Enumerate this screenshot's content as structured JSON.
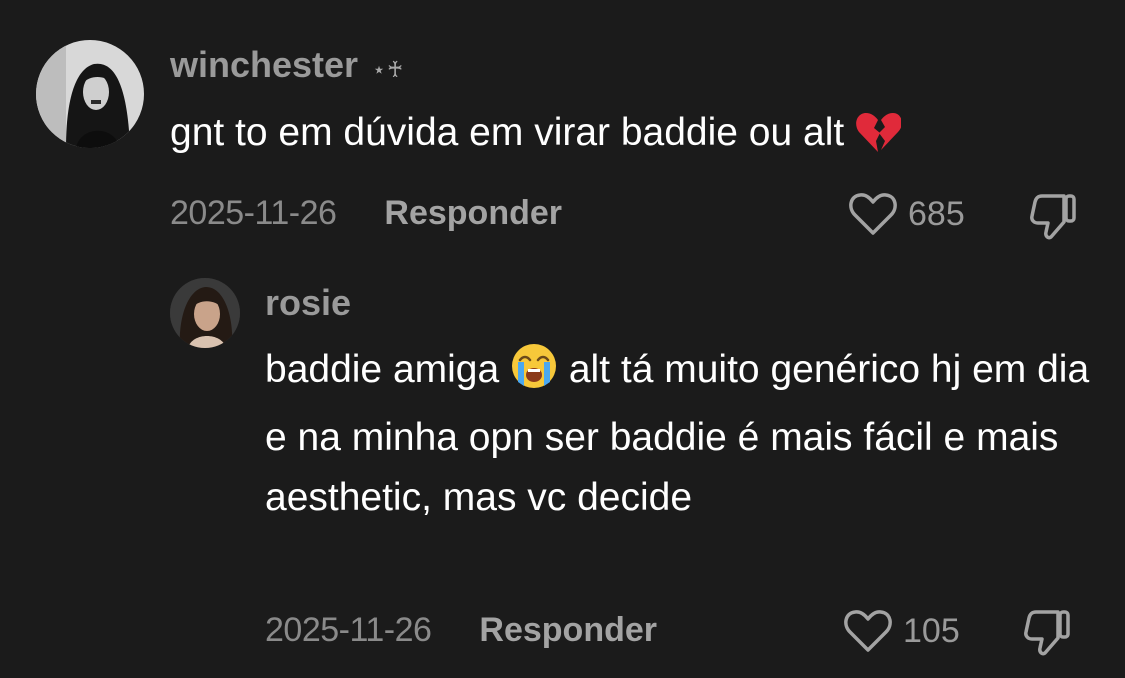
{
  "comments": [
    {
      "username": "winchester",
      "badge": "⋆♰",
      "text": "gnt to em dúvida em virar baddie ou alt",
      "text_emoji": "broken-heart-emoji",
      "date": "2025-11-26",
      "reply_label": "Responder",
      "likes": "685"
    },
    {
      "username": "rosie",
      "text_before_emoji": "baddie amiga",
      "text_emoji": "loudly-crying-face-emoji",
      "text_after_emoji": "alt tá muito genérico hj em dia e na minha opn ser baddie é mais fácil e mais aesthetic, mas vc decide",
      "date": "2025-11-26",
      "reply_label": "Responder",
      "likes": "105"
    }
  ],
  "colors": {
    "background": "#1b1b1b",
    "username": "#9a9a9a",
    "body_text": "#ffffff",
    "meta_text": "#8a8a8a",
    "broken_heart": "#e02a3a"
  }
}
